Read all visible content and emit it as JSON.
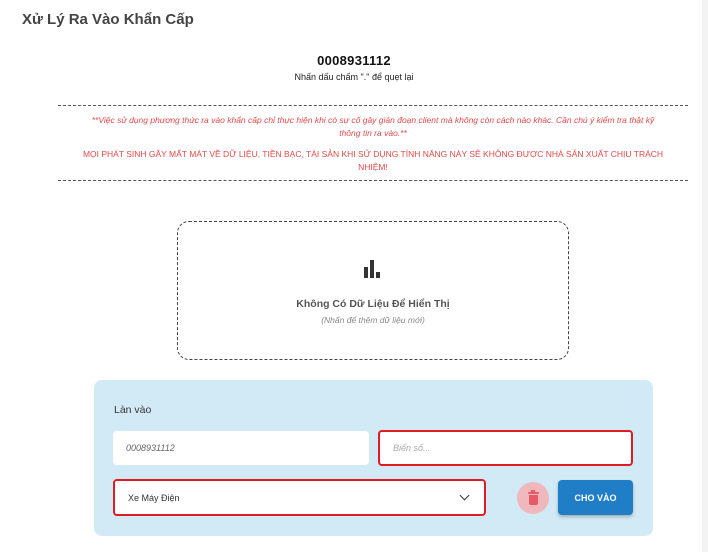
{
  "page": {
    "title": "Xử Lý Ra Vào Khẩn Cấp"
  },
  "scan": {
    "card_number": "0008931112",
    "rescan_hint": "Nhấn dấu chấm \".\" để quẹt lại"
  },
  "warning": {
    "line1": "**Việc sử dụng phương thức ra vào khẩn cấp chỉ thực hiện khi có sự cố gây gián đoạn client mà không còn cách nào khác. Cần chú ý kiểm tra thật kỹ thông tin ra vào.**",
    "line2": "MỌI PHÁT SINH GÂY MẤT MÁT VỀ DỮ LIỆU, TIỀN BẠC, TÀI SẢN KHI SỬ DỤNG TÍNH NĂNG NÀY SẼ KHÔNG ĐƯỢC NHÀ SẢN XUẤT CHỊU TRÁCH NHIỆM!"
  },
  "empty_state": {
    "icon": "bar-chart-icon",
    "title": "Không Có Dữ Liệu Để Hiển Thị",
    "subtitle": "(Nhấn để thêm dữ liệu mới)"
  },
  "form": {
    "lane_label": "Làn vào",
    "card_field_value": "0008931112",
    "plate_placeholder": "Biển số...",
    "vehicle_selected": "Xe Máy Điện",
    "delete_icon": "trash-icon",
    "submit_label": "CHO VÀO",
    "colors": {
      "panel_bg": "#d2eaf5",
      "error_border": "#e01b24",
      "primary": "#1f7ec6",
      "warning_text": "#e04a4a"
    }
  }
}
